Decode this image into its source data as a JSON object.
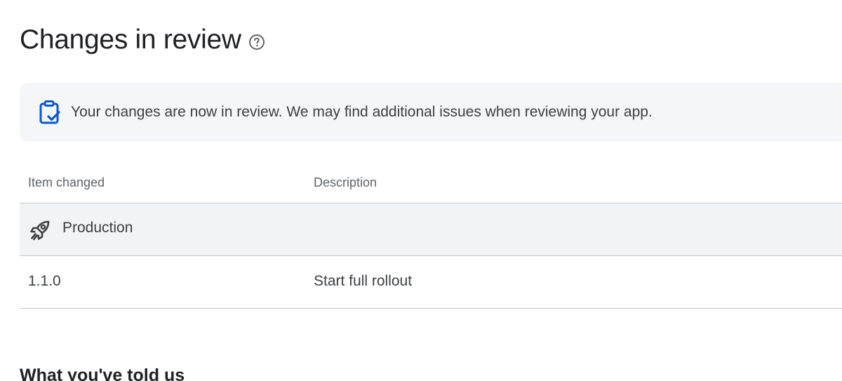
{
  "header": {
    "title": "Changes in review",
    "help_icon": "help-circle-icon"
  },
  "banner": {
    "icon": "clipboard-check-icon",
    "icon_color": "#0b57d0",
    "message": "Your changes are now in review. We may find additional issues when reviewing your app."
  },
  "changes_table": {
    "columns": [
      "Item changed",
      "Description"
    ],
    "groups": [
      {
        "icon": "rocket-icon",
        "label": "Production",
        "rows": [
          {
            "item": "1.1.0",
            "description": "Start full rollout"
          }
        ]
      }
    ]
  },
  "next_section": {
    "heading": "What you've told us"
  },
  "colors": {
    "banner_bg": "#f4f6f9",
    "group_row_bg": "#f1f3f4",
    "divider": "#c4c7c5",
    "text_primary": "#202124",
    "text_secondary": "#5f6368"
  }
}
